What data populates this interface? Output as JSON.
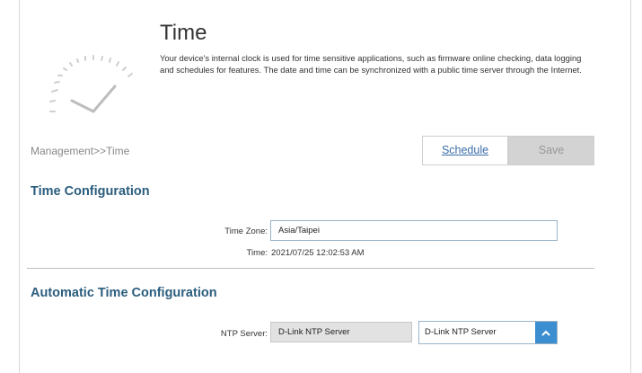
{
  "header": {
    "title": "Time",
    "description": "Your device's internal clock is used for time sensitive applications, such as firmware online checking, data logging and schedules for features. The date and time can be synchronized with a public time server through the Internet."
  },
  "breadcrumb": "Management>>Time",
  "toolbar": {
    "schedule_label": "Schedule",
    "save_label": "Save"
  },
  "time_config": {
    "title": "Time Configuration",
    "time_zone_label": "Time Zone:",
    "time_zone_value": "Asia/Taipei",
    "time_label": "Time:",
    "time_value": "2021/07/25 12:02:53 AM"
  },
  "auto_time_config": {
    "title": "Automatic Time Configuration",
    "ntp_server_label": "NTP Server:",
    "ntp_server_value": "D-Link NTP Server",
    "ntp_server_select": "D-Link NTP Server"
  },
  "colors": {
    "accent": "#2b5d7e",
    "link": "#3b6ea8",
    "select_button": "#3b8ed0"
  }
}
